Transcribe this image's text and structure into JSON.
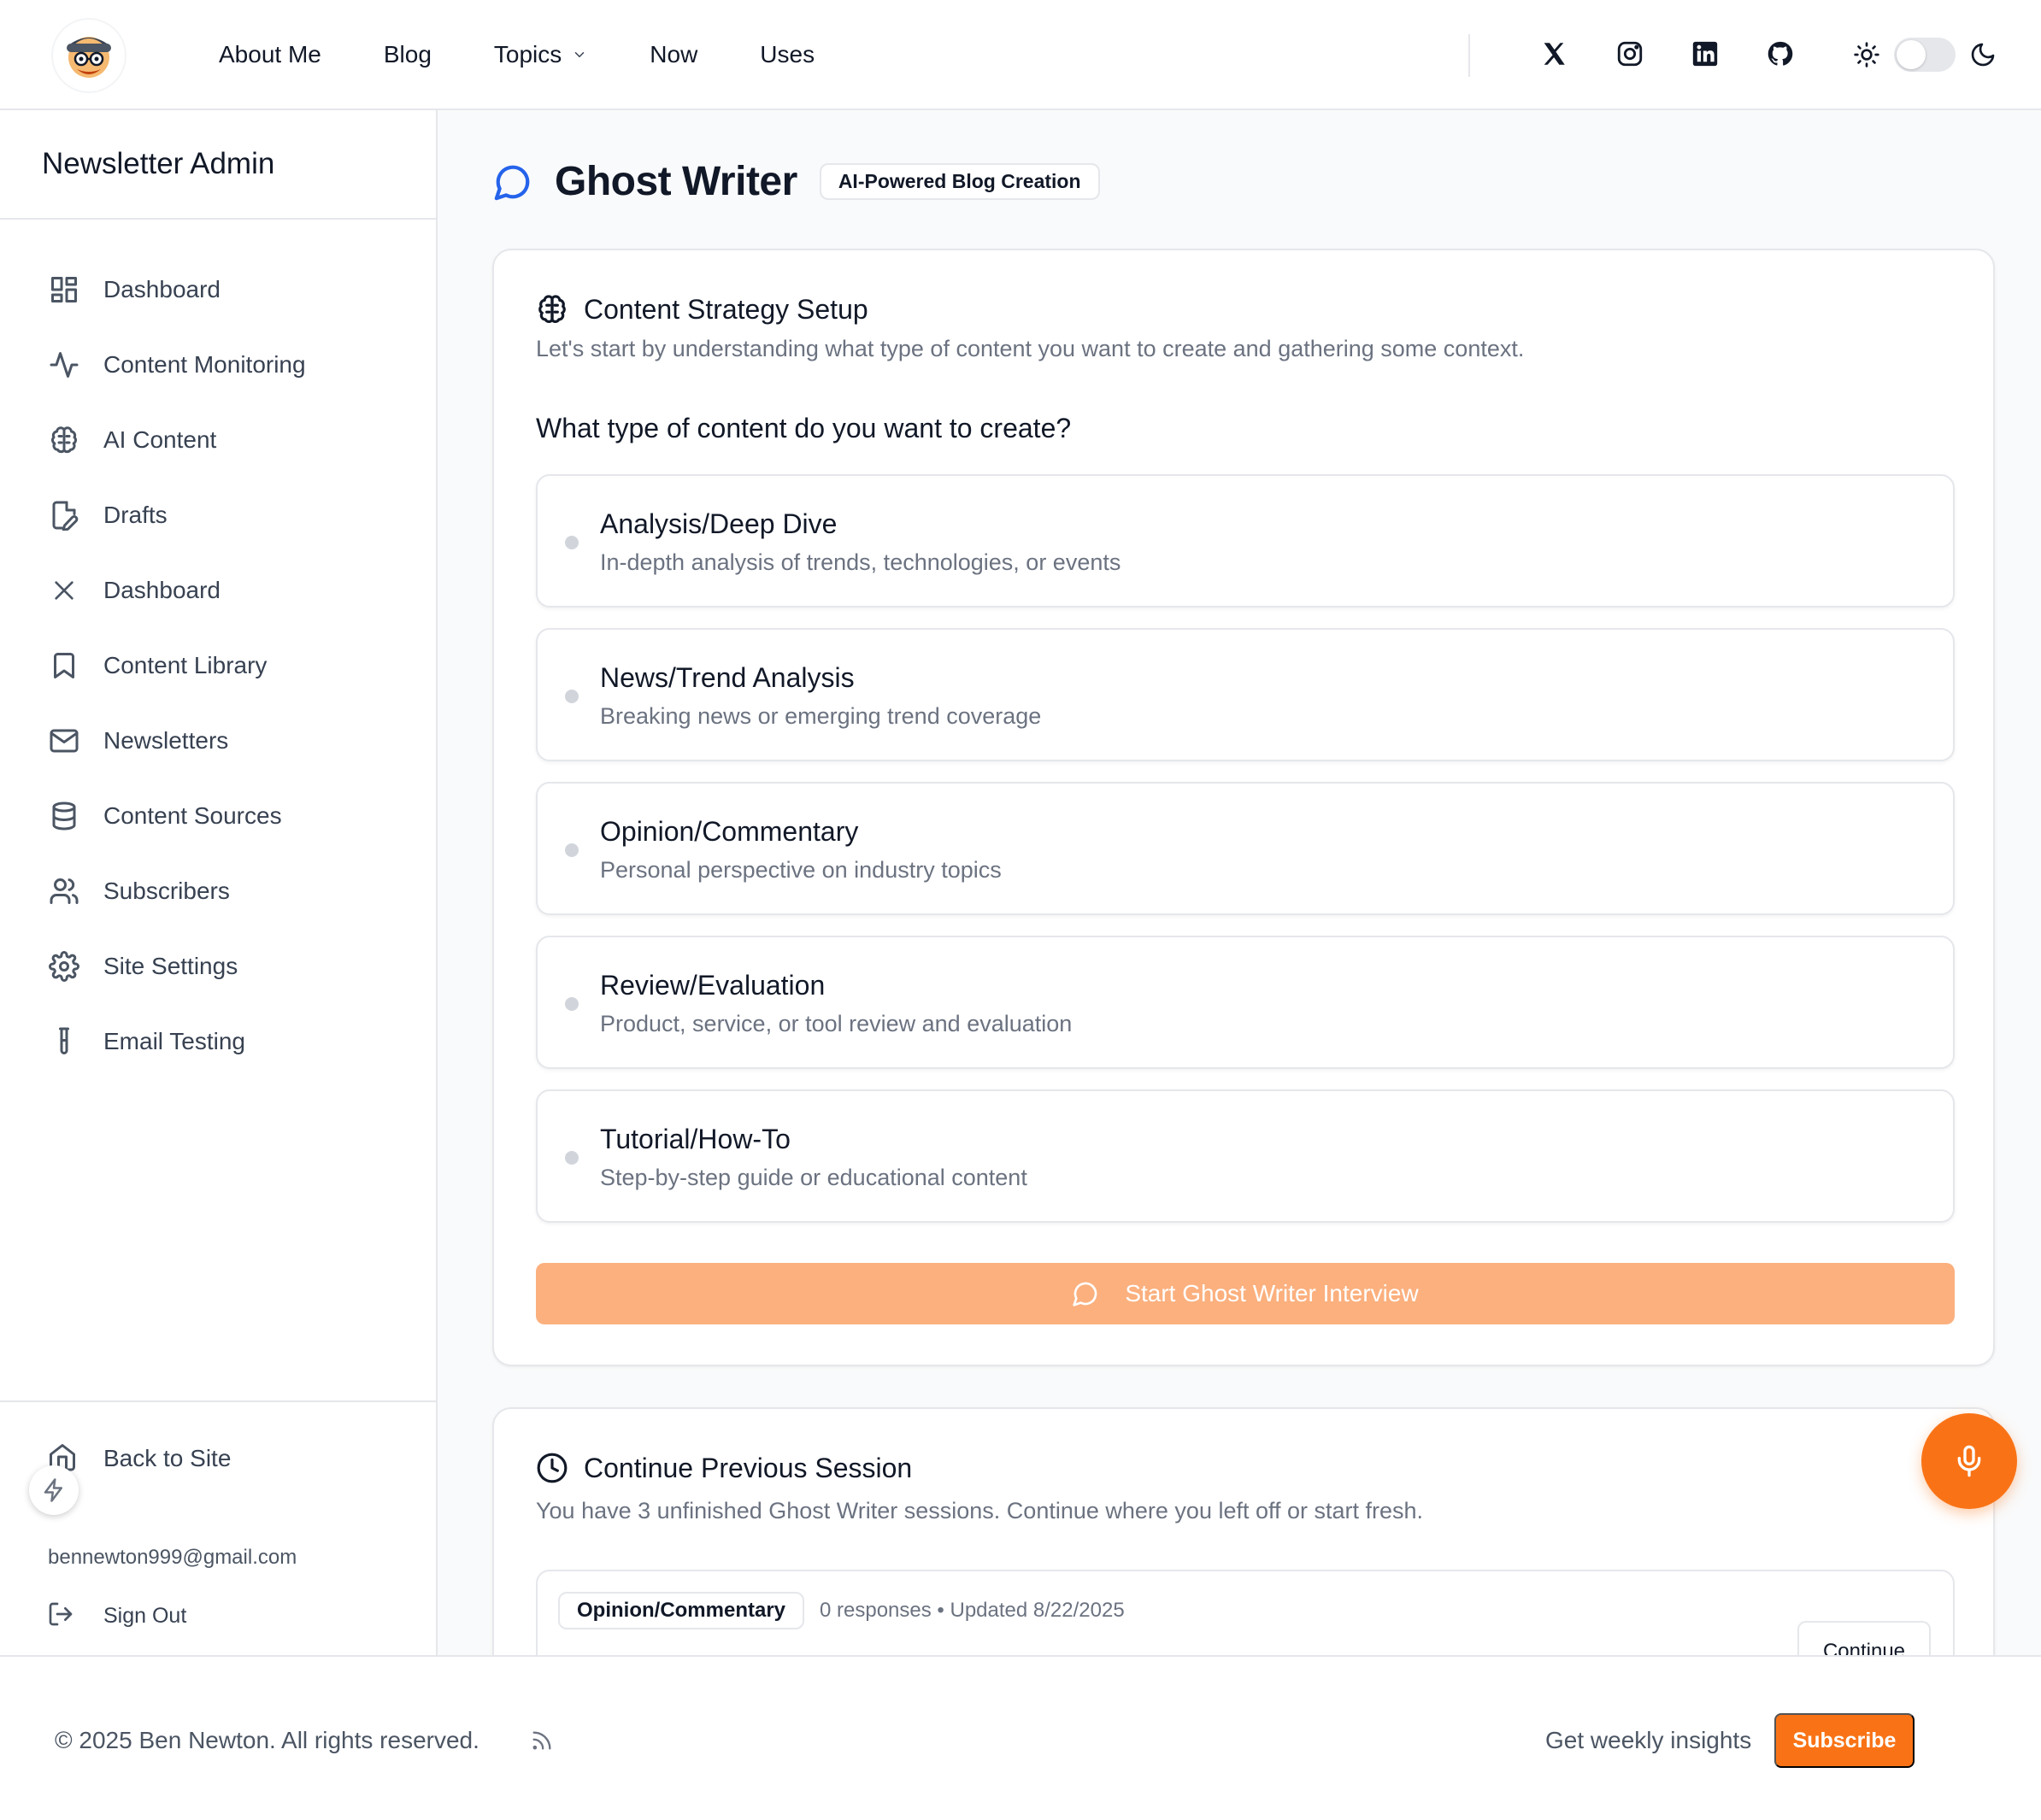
{
  "header": {
    "nav": [
      "About Me",
      "Blog",
      "Topics",
      "Now",
      "Uses"
    ],
    "socials": [
      "x-icon",
      "instagram-icon",
      "linkedin-icon",
      "github-icon"
    ]
  },
  "sidebar": {
    "title": "Newsletter Admin",
    "items": [
      {
        "label": "Dashboard",
        "icon": "dashboard-icon"
      },
      {
        "label": "Content Monitoring",
        "icon": "activity-icon"
      },
      {
        "label": "AI Content",
        "icon": "brain-icon"
      },
      {
        "label": "Drafts",
        "icon": "file-edit-icon"
      },
      {
        "label": "Dashboard",
        "icon": "x-close-icon"
      },
      {
        "label": "Content Library",
        "icon": "bookmark-icon"
      },
      {
        "label": "Newsletters",
        "icon": "mail-icon"
      },
      {
        "label": "Content Sources",
        "icon": "database-icon"
      },
      {
        "label": "Subscribers",
        "icon": "users-icon"
      },
      {
        "label": "Site Settings",
        "icon": "gear-icon"
      },
      {
        "label": "Email Testing",
        "icon": "test-tube-icon"
      }
    ],
    "back_to_site": "Back to Site",
    "email": "bennewton999@gmail.com",
    "sign_out": "Sign Out"
  },
  "page": {
    "title": "Ghost Writer",
    "badge": "AI-Powered Blog Creation"
  },
  "setup_card": {
    "title": "Content Strategy Setup",
    "description": "Let's start by understanding what type of content you want to create and gathering some context.",
    "question": "What type of content do you want to create?",
    "options": [
      {
        "title": "Analysis/Deep Dive",
        "description": "In-depth analysis of trends, technologies, or events"
      },
      {
        "title": "News/Trend Analysis",
        "description": "Breaking news or emerging trend coverage"
      },
      {
        "title": "Opinion/Commentary",
        "description": "Personal perspective on industry topics"
      },
      {
        "title": "Review/Evaluation",
        "description": "Product, service, or tool review and evaluation"
      },
      {
        "title": "Tutorial/How-To",
        "description": "Step-by-step guide or educational content"
      }
    ],
    "start_button": "Start Ghost Writer Interview"
  },
  "session_card": {
    "title": "Continue Previous Session",
    "description": "You have 3 unfinished Ghost Writer sessions. Continue where you left off or start fresh.",
    "sessions": [
      {
        "type": "Opinion/Commentary",
        "meta": "0 responses • Updated 8/22/2025",
        "action": "Continue"
      }
    ]
  },
  "footer": {
    "copyright": "© 2025 Ben Newton. All rights reserved.",
    "cta_text": "Get weekly insights",
    "subscribe": "Subscribe"
  },
  "colors": {
    "accent": "#f97316",
    "accent_disabled": "#fbb07e",
    "title_icon": "#2563eb"
  }
}
